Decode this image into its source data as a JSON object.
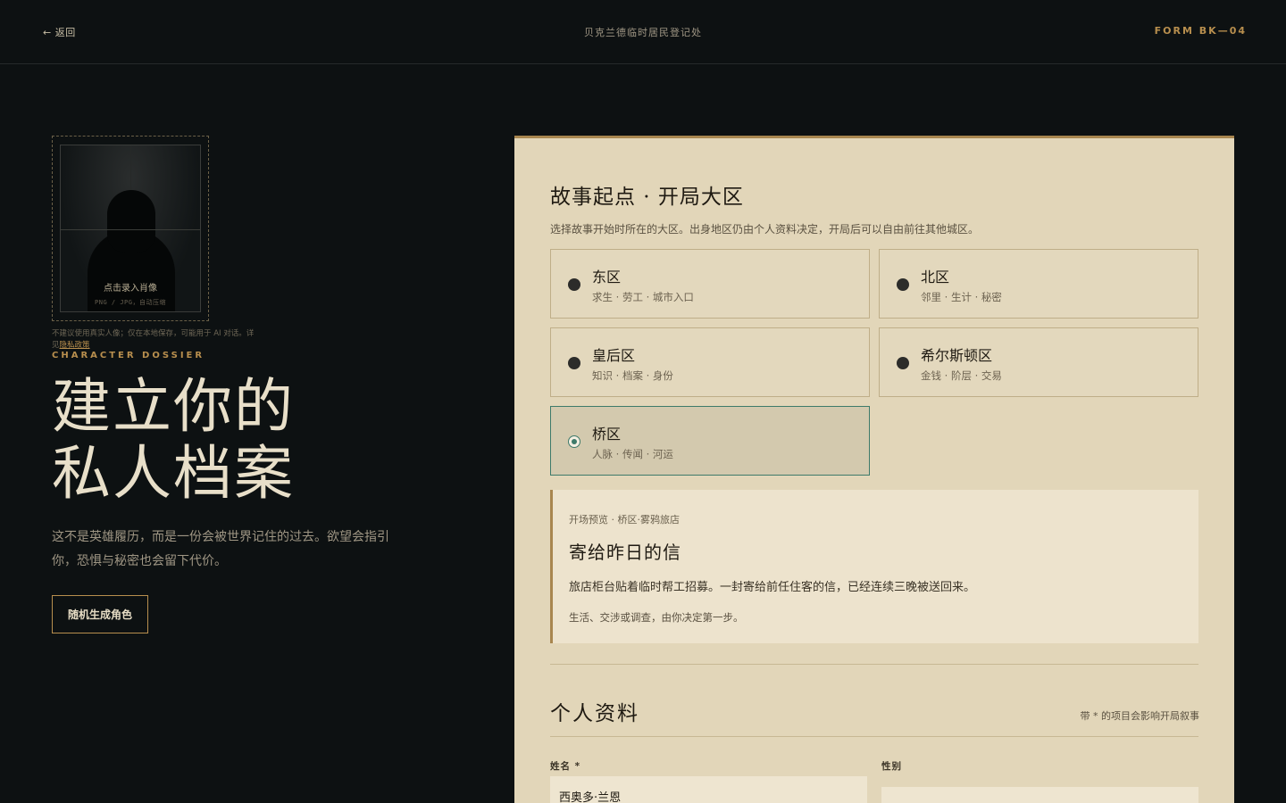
{
  "header": {
    "back_label": "← 返回",
    "title": "贝克兰德临时居民登记处",
    "form_code": "FORM BK—04"
  },
  "portrait": {
    "label": "点击录入肖像",
    "hint": "PNG / JPG，自动压缩",
    "privacy_text": "不建议使用真实人像；仅在本地保存，可能用于 AI 对话。详见",
    "privacy_link": "隐私政策"
  },
  "hero": {
    "eyebrow": "CHARACTER DOSSIER",
    "title_line1": "建立你的",
    "title_line2": "私人档案",
    "subtitle": "这不是英雄履历，而是一份会被世界记住的过去。欲望会指引你，恐惧与秘密也会留下代价。",
    "random_button": "随机生成角色"
  },
  "start": {
    "title": "故事起点 · 开局大区",
    "description": "选择故事开始时所在的大区。出身地区仍由个人资料决定，开局后可以自由前往其他城区。",
    "districts": [
      {
        "name": "东区",
        "tags": "求生 · 劳工 · 城市入口",
        "selected": false
      },
      {
        "name": "北区",
        "tags": "邻里 · 生计 · 秘密",
        "selected": false
      },
      {
        "name": "皇后区",
        "tags": "知识 · 档案 · 身份",
        "selected": false
      },
      {
        "name": "希尔斯顿区",
        "tags": "金钱 · 阶层 · 交易",
        "selected": false
      },
      {
        "name": "桥区",
        "tags": "人脉 · 传闻 · 河运",
        "selected": true
      }
    ],
    "preview": {
      "eyebrow": "开场预览 · 桥区·雾鸦旅店",
      "title": "寄给昨日的信",
      "body": "旅店柜台贴着临时帮工招募。一封寄给前任住客的信，已经连续三晚被送回来。",
      "hint": "生活、交涉或调查，由你决定第一步。"
    }
  },
  "profile": {
    "title": "个人资料",
    "note": "带 * 的项目会影响开局叙事",
    "name_label": "姓名 *",
    "name_value": "西奥多·兰恩",
    "gender_label": "性别",
    "gender_value": ""
  },
  "colors": {
    "background": "#0d1112",
    "accent_gold": "#b88f4e",
    "card": "#e2d6b9",
    "selected_teal": "#3e7a6a"
  }
}
